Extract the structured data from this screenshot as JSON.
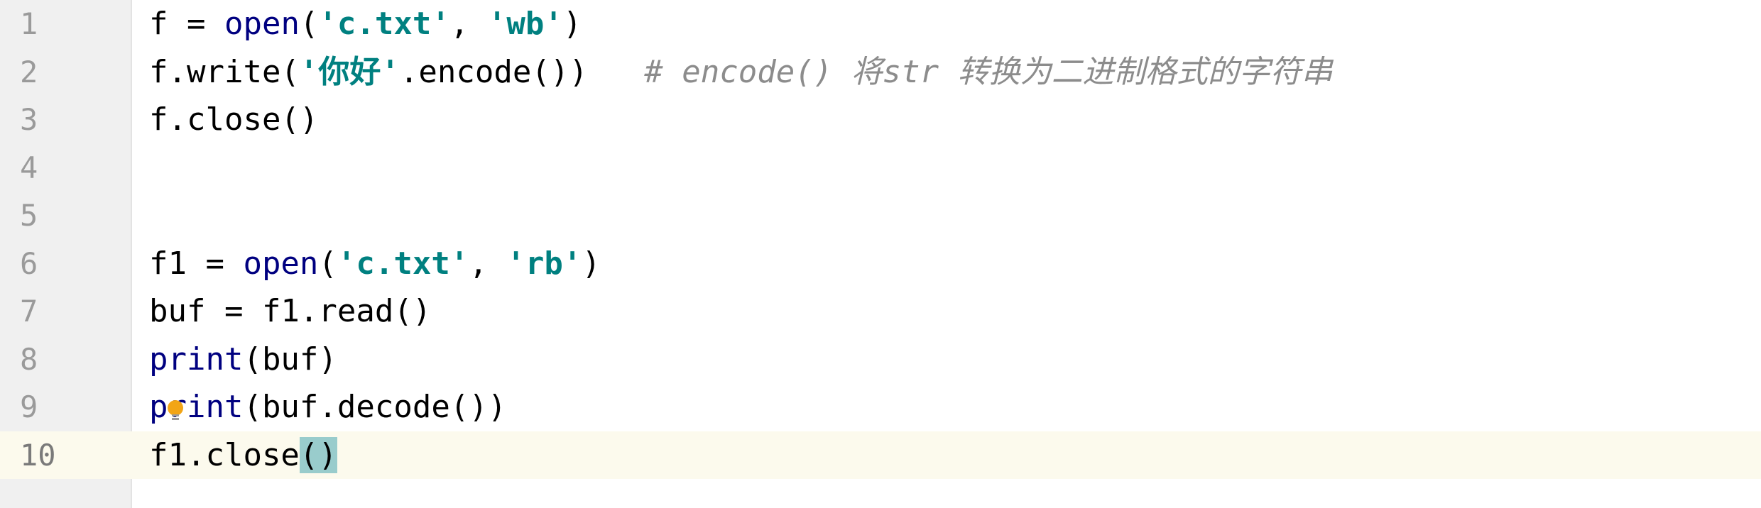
{
  "editor": {
    "lines": [
      {
        "number": "1",
        "tokens": [
          {
            "t": "f = ",
            "c": ""
          },
          {
            "t": "open",
            "c": "kw"
          },
          {
            "t": "(",
            "c": ""
          },
          {
            "t": "'c.txt'",
            "c": "str"
          },
          {
            "t": ", ",
            "c": ""
          },
          {
            "t": "'wb'",
            "c": "str"
          },
          {
            "t": ")",
            "c": ""
          }
        ]
      },
      {
        "number": "2",
        "tokens": [
          {
            "t": "f.write(",
            "c": ""
          },
          {
            "t": "'你好'",
            "c": "cjk-str"
          },
          {
            "t": ".encode())   ",
            "c": ""
          },
          {
            "t": "# encode() 将str 转换为二进制格式的字符串",
            "c": "cmt"
          }
        ]
      },
      {
        "number": "3",
        "tokens": [
          {
            "t": "f.close()",
            "c": ""
          }
        ]
      },
      {
        "number": "4",
        "tokens": []
      },
      {
        "number": "5",
        "tokens": []
      },
      {
        "number": "6",
        "tokens": [
          {
            "t": "f1 = ",
            "c": ""
          },
          {
            "t": "open",
            "c": "kw"
          },
          {
            "t": "(",
            "c": ""
          },
          {
            "t": "'c.txt'",
            "c": "str"
          },
          {
            "t": ", ",
            "c": ""
          },
          {
            "t": "'rb'",
            "c": "str"
          },
          {
            "t": ")",
            "c": ""
          }
        ]
      },
      {
        "number": "7",
        "tokens": [
          {
            "t": "buf = f1.read()",
            "c": ""
          }
        ]
      },
      {
        "number": "8",
        "tokens": [
          {
            "t": "print",
            "c": "kw"
          },
          {
            "t": "(buf)",
            "c": ""
          }
        ]
      },
      {
        "number": "9",
        "tokens": [
          {
            "t": "print",
            "c": "kw"
          },
          {
            "t": "(buf.decode())",
            "c": ""
          }
        ]
      },
      {
        "number": "10",
        "tokens": [
          {
            "t": "f1.close",
            "c": ""
          },
          {
            "t": "()",
            "c": "match"
          }
        ]
      }
    ],
    "current_line": 10,
    "intention_bulb_line": 9,
    "colors": {
      "keyword": "#000080",
      "string": "#008080",
      "comment": "#8c8c8c",
      "current_line_bg": "#fcfaed",
      "brace_match_bg": "#99cccc",
      "bulb": "#f2a516"
    },
    "icons": {
      "intention": "lightbulb-icon"
    }
  }
}
